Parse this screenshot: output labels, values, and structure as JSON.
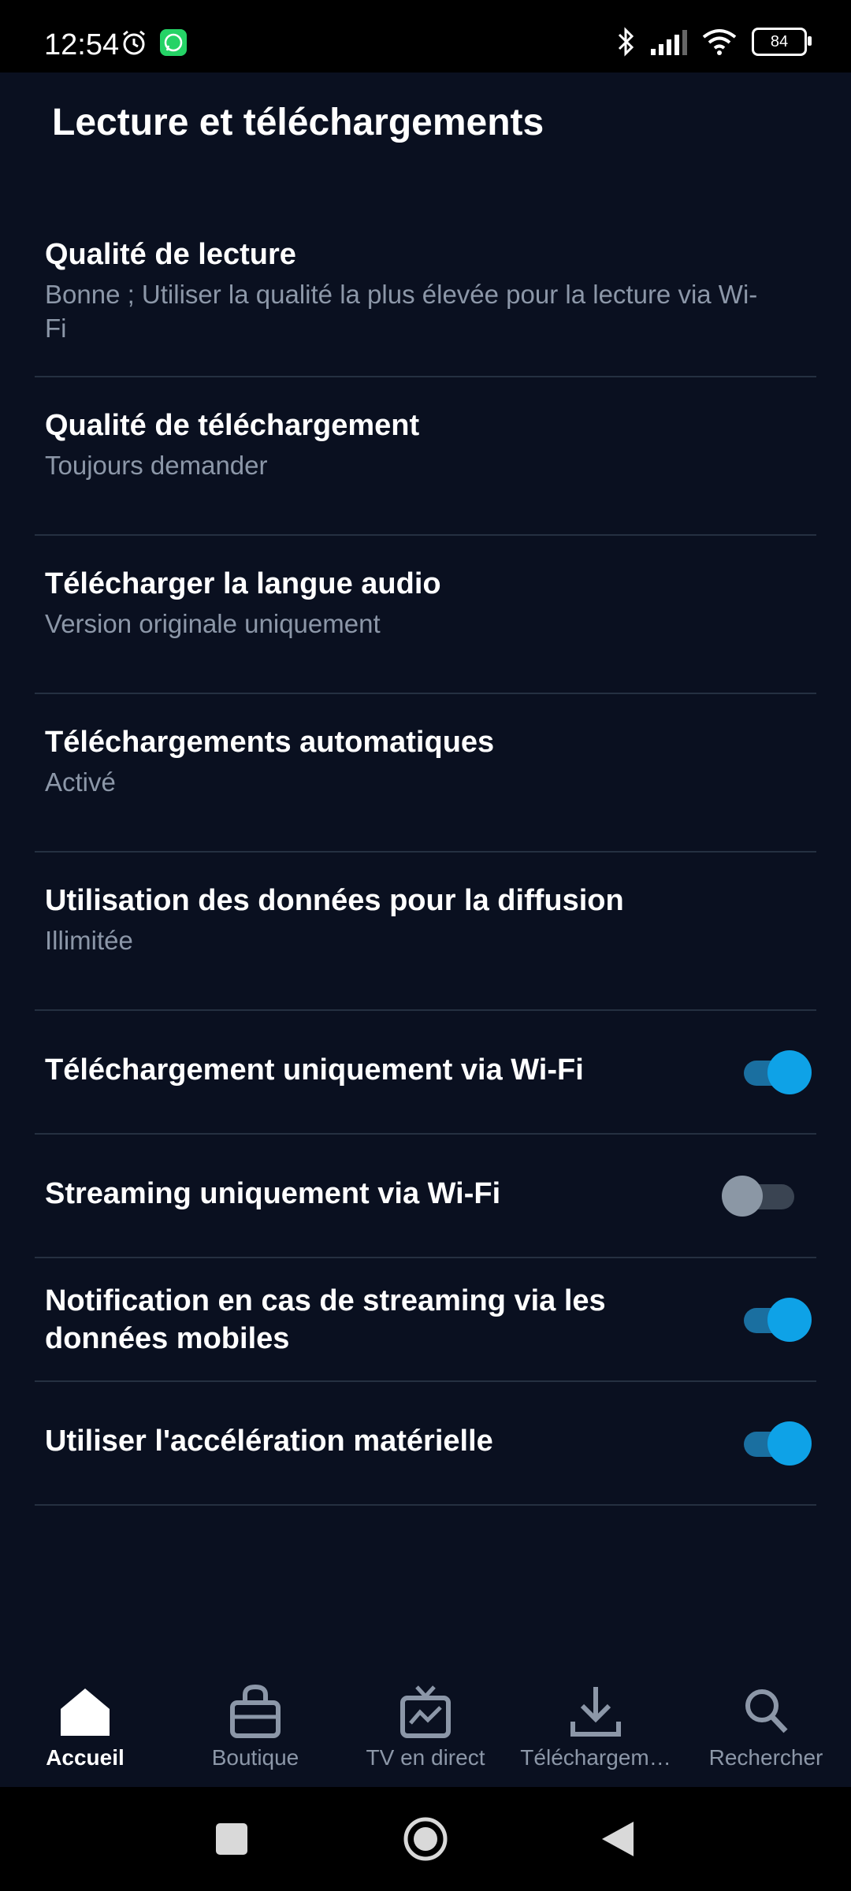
{
  "status_bar": {
    "time": "12:54",
    "battery": "84"
  },
  "page": {
    "title": "Lecture et téléchargements"
  },
  "settings": [
    {
      "label": "Qualité de lecture",
      "sub": "Bonne ; Utiliser la qualité la plus élevée pour la lecture via Wi-Fi"
    },
    {
      "label": "Qualité de téléchargement",
      "sub": "Toujours demander"
    },
    {
      "label": "Télécharger la langue audio",
      "sub": "Version originale uniquement"
    },
    {
      "label": "Téléchargements automatiques",
      "sub": "Activé"
    },
    {
      "label": "Utilisation des données pour la diffusion",
      "sub": "Illimitée"
    }
  ],
  "toggles": [
    {
      "label": "Téléchargement uniquement via Wi-Fi",
      "on": true
    },
    {
      "label": "Streaming uniquement via Wi-Fi",
      "on": false
    },
    {
      "label": "Notification en cas de streaming via les données mobiles",
      "on": true
    },
    {
      "label": "Utiliser l'accélération matérielle",
      "on": true
    }
  ],
  "bottom_nav": [
    {
      "label": "Accueil",
      "icon": "home-icon",
      "active": true
    },
    {
      "label": "Boutique",
      "icon": "shopping-bag-icon",
      "active": false
    },
    {
      "label": "TV en direct",
      "icon": "live-tv-icon",
      "active": false
    },
    {
      "label": "Téléchargem…",
      "icon": "download-icon",
      "active": false
    },
    {
      "label": "Rechercher",
      "icon": "search-icon",
      "active": false
    }
  ],
  "colors": {
    "accent": "#0ea2e7",
    "background": "#0a1020",
    "secondary_text": "#8c97a8"
  }
}
